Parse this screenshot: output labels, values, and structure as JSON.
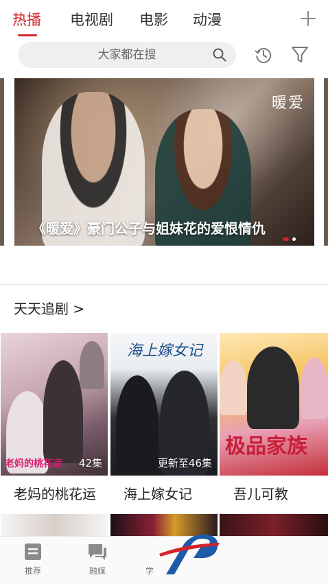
{
  "tabs": [
    {
      "label": "热播",
      "active": true
    },
    {
      "label": "电视剧",
      "active": false
    },
    {
      "label": "电影",
      "active": false
    },
    {
      "label": "动漫",
      "active": false
    }
  ],
  "search": {
    "placeholder": "大家都在搜"
  },
  "banner": {
    "caption": "《暖爱》豪门公子与姐妹花的爱恨情仇",
    "logo_text": "暖爱",
    "dots": 2,
    "active_dot": 1
  },
  "section": {
    "title": "天天追剧 >"
  },
  "shows": [
    {
      "title": "老妈的桃花运",
      "badge": "42集",
      "art_title": "老妈的桃花运"
    },
    {
      "title": "海上嫁女记",
      "badge": "更新至46集",
      "art_title": "海上嫁女记"
    },
    {
      "title": "吾儿可教",
      "badge": "",
      "art_title": "极品家族"
    }
  ],
  "bottom_nav": [
    {
      "label": "推荐",
      "icon": "document-icon"
    },
    {
      "label": "融媒",
      "icon": "chat-icon"
    },
    {
      "label": "学",
      "icon": "study-icon"
    }
  ],
  "colors": {
    "accent": "#d3232a",
    "logo_blue": "#1d5aa8"
  }
}
